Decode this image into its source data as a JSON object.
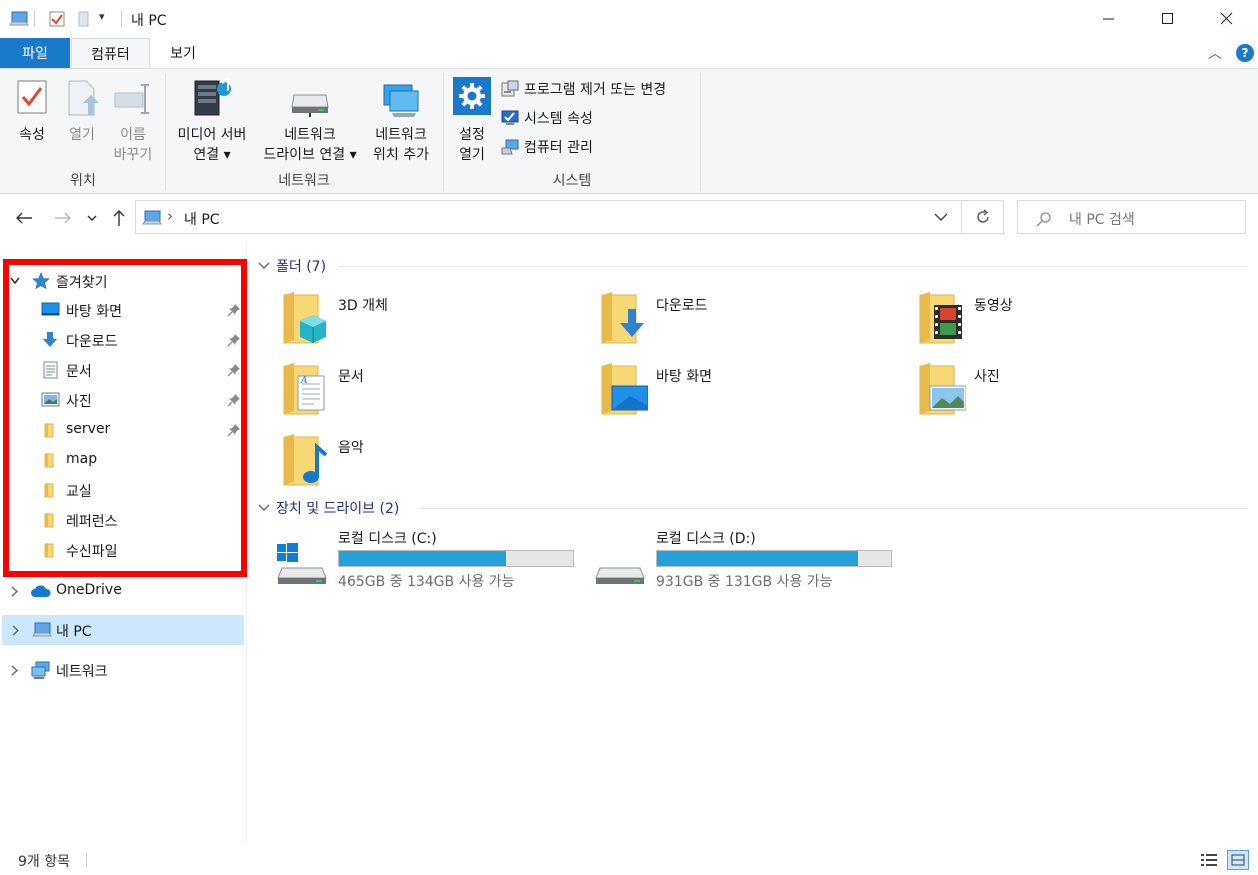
{
  "window": {
    "title": "내 PC",
    "qat_dropdown_glyph": "▾",
    "minimize_icon": "minimize-icon",
    "maximize_icon": "maximize-icon",
    "close_icon": "close-icon"
  },
  "ribbon": {
    "tabs": [
      "파일",
      "컴퓨터",
      "보기"
    ],
    "active_tab": "컴퓨터",
    "groups": {
      "location": {
        "label": "위치",
        "buttons": [
          {
            "label": "속성",
            "enabled": true
          },
          {
            "label": "열기",
            "enabled": false
          },
          {
            "label_line1": "이름",
            "label_line2": "바꾸기",
            "enabled": false
          }
        ]
      },
      "network": {
        "label": "네트워크",
        "buttons": [
          {
            "label_line1": "미디어 서버",
            "label_line2": "연결 ▾"
          },
          {
            "label_line1": "네트워크",
            "label_line2": "드라이브 연결 ▾"
          },
          {
            "label_line1": "네트워크",
            "label_line2": "위치 추가"
          }
        ]
      },
      "system": {
        "label": "시스템",
        "settings_line1": "설정",
        "settings_line2": "열기",
        "items": [
          "프로그램 제거 또는 변경",
          "시스템 속성",
          "컴퓨터 관리"
        ]
      }
    },
    "collapse_glyph": "︿",
    "help_glyph": "?"
  },
  "address": {
    "separator": "›",
    "path": "내 PC",
    "search_placeholder": "내 PC 검색"
  },
  "sidebar": {
    "favorites_label": "즐겨찾기",
    "favorites": [
      {
        "label": "바탕 화면",
        "icon": "desktop-icon",
        "pinned": true
      },
      {
        "label": "다운로드",
        "icon": "download-icon",
        "pinned": true
      },
      {
        "label": "문서",
        "icon": "document-icon",
        "pinned": true
      },
      {
        "label": "사진",
        "icon": "picture-icon",
        "pinned": true
      },
      {
        "label": "server",
        "icon": "folder-icon",
        "pinned": true
      },
      {
        "label": "map",
        "icon": "folder-icon",
        "pinned": false
      },
      {
        "label": "교실",
        "icon": "folder-icon",
        "pinned": false
      },
      {
        "label": "레퍼런스",
        "icon": "folder-icon",
        "pinned": false
      },
      {
        "label": "수신파일",
        "icon": "folder-icon",
        "pinned": false
      }
    ],
    "roots": [
      {
        "label": "OneDrive",
        "icon": "onedrive-icon"
      },
      {
        "label": "내 PC",
        "icon": "this-pc-icon",
        "selected": true
      },
      {
        "label": "네트워크",
        "icon": "network-icon"
      }
    ]
  },
  "content": {
    "folders_header": "폴더 (7)",
    "folders": [
      "3D 개체",
      "다운로드",
      "동영상",
      "문서",
      "바탕 화면",
      "사진",
      "음악"
    ],
    "drives_header": "장치 및 드라이브 (2)",
    "drives": [
      {
        "name": "로컬 디스크 (C:)",
        "free_text": "465GB 중 134GB 사용 가능",
        "used_fraction": 0.712
      },
      {
        "name": "로컬 디스크 (D:)",
        "free_text": "931GB 중 131GB 사용 가능",
        "used_fraction": 0.859
      }
    ]
  },
  "status": {
    "item_count": "9개 항목"
  },
  "colors": {
    "accent": "#1979ca",
    "selection": "#cce8ff",
    "highlight_frame": "#ff0000",
    "drive_bar": "#26a0da",
    "folder_yellow": "#f8d775",
    "section_header": "#1e3287"
  }
}
